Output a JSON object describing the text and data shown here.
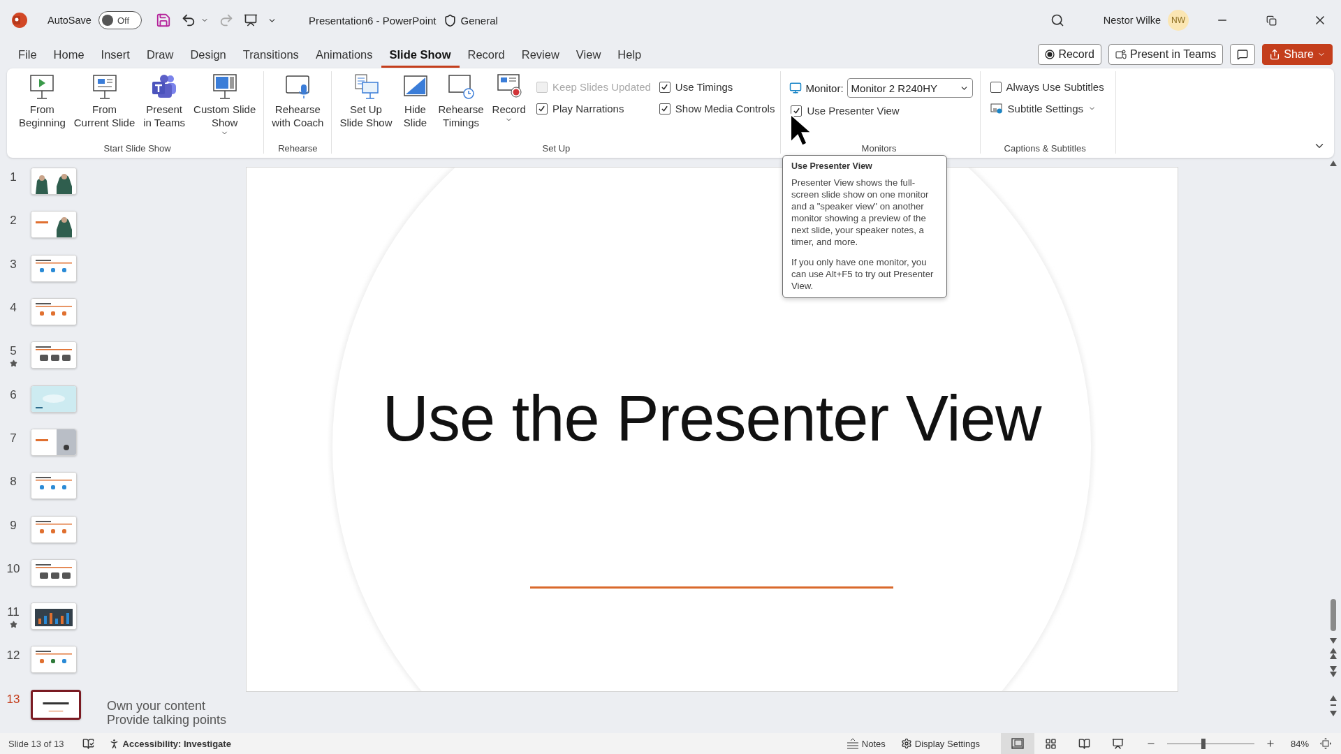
{
  "title_bar": {
    "autosave_label": "AutoSave",
    "autosave_on": false,
    "autosave_state": "Off",
    "document_title": "Presentation6  -  PowerPoint",
    "sensitivity": "General",
    "user_name": "Nestor Wilke",
    "user_initials": "NW"
  },
  "tabs": [
    {
      "label": "File",
      "selected": false
    },
    {
      "label": "Home",
      "selected": false
    },
    {
      "label": "Insert",
      "selected": false
    },
    {
      "label": "Draw",
      "selected": false
    },
    {
      "label": "Design",
      "selected": false
    },
    {
      "label": "Transitions",
      "selected": false
    },
    {
      "label": "Animations",
      "selected": false
    },
    {
      "label": "Slide Show",
      "selected": true
    },
    {
      "label": "Record",
      "selected": false
    },
    {
      "label": "Review",
      "selected": false
    },
    {
      "label": "View",
      "selected": false
    },
    {
      "label": "Help",
      "selected": false
    }
  ],
  "header_buttons": {
    "record": "Record",
    "present_in_teams": "Present in Teams",
    "share": "Share"
  },
  "ribbon": {
    "start_slide_show": {
      "label": "Start Slide Show",
      "buttons": [
        {
          "lines": [
            "From",
            "Beginning"
          ],
          "has_menu": false
        },
        {
          "lines": [
            "From",
            "Current Slide"
          ],
          "has_menu": false
        },
        {
          "lines": [
            "Present",
            "in Teams"
          ],
          "has_menu": false
        },
        {
          "lines": [
            "Custom Slide",
            "Show"
          ],
          "has_menu": true
        }
      ]
    },
    "rehearse": {
      "label": "Rehearse",
      "buttons": [
        {
          "lines": [
            "Rehearse",
            "with Coach"
          ],
          "has_menu": false
        }
      ]
    },
    "set_up": {
      "label": "Set Up",
      "buttons": [
        {
          "lines": [
            "Set Up",
            "Slide Show"
          ],
          "has_menu": false
        },
        {
          "lines": [
            "Hide",
            "Slide"
          ],
          "has_menu": false
        },
        {
          "lines": [
            "Rehearse",
            "Timings"
          ],
          "has_menu": false
        },
        {
          "lines": [
            "Record"
          ],
          "has_menu": true
        }
      ],
      "checks": [
        {
          "label": "Keep Slides Updated",
          "checked": false,
          "disabled": true
        },
        {
          "label": "Play Narrations",
          "checked": true,
          "disabled": false
        },
        {
          "label": "Use Timings",
          "checked": true,
          "disabled": false
        },
        {
          "label": "Show Media Controls",
          "checked": true,
          "disabled": false
        }
      ]
    },
    "monitors": {
      "label": "Monitors",
      "monitor_label": "Monitor:",
      "monitor_value": "Monitor 2 R240HY",
      "presenter_view": {
        "label": "Use Presenter View",
        "checked": true
      }
    },
    "captions": {
      "label": "Captions & Subtitles",
      "always_subtitles": {
        "label": "Always Use Subtitles",
        "checked": false
      },
      "subtitle_settings": "Subtitle Settings"
    }
  },
  "tooltip": {
    "title": "Use Presenter View",
    "paragraphs": [
      "Presenter View shows the full-screen slide show on one monitor and a \"speaker view\" on another monitor showing a preview of the next slide, your speaker notes, a timer, and more.",
      "If you only have one monitor, you can use Alt+F5 to try out Presenter View."
    ]
  },
  "slides": [
    {
      "number": "1",
      "starred": false,
      "selected": false
    },
    {
      "number": "2",
      "starred": false,
      "selected": false
    },
    {
      "number": "3",
      "starred": false,
      "selected": false
    },
    {
      "number": "4",
      "starred": false,
      "selected": false
    },
    {
      "number": "5",
      "starred": true,
      "selected": false
    },
    {
      "number": "6",
      "starred": false,
      "selected": false
    },
    {
      "number": "7",
      "starred": false,
      "selected": false
    },
    {
      "number": "8",
      "starred": false,
      "selected": false
    },
    {
      "number": "9",
      "starred": false,
      "selected": false
    },
    {
      "number": "10",
      "starred": false,
      "selected": false
    },
    {
      "number": "11",
      "starred": true,
      "selected": false
    },
    {
      "number": "12",
      "starred": false,
      "selected": false
    },
    {
      "number": "13",
      "starred": false,
      "selected": true
    }
  ],
  "slide": {
    "title": "Use the Presenter View"
  },
  "notes": [
    "Own your content",
    "Provide talking points"
  ],
  "status_bar": {
    "slide_position": "Slide 13 of 13",
    "accessibility": "Accessibility: Investigate",
    "notes": "Notes",
    "display_settings": "Display Settings",
    "views": [
      {
        "selected": true
      },
      {
        "selected": false
      },
      {
        "selected": false
      },
      {
        "selected": false
      }
    ],
    "zoom": {
      "level": 0.42,
      "reading": "84%"
    }
  }
}
